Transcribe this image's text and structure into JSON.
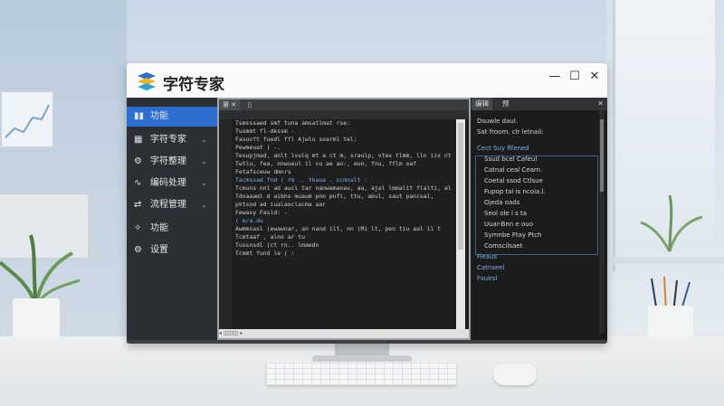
{
  "window": {
    "app_title": "字符专家",
    "minimize_label": "—",
    "maximize_label": "☐",
    "close_label": "✕"
  },
  "sidebar": {
    "items": [
      {
        "label": "功能",
        "icon": "bar-chart-icon",
        "glyph": "▮▮",
        "chevron": "",
        "active": true
      },
      {
        "label": "字符专家",
        "icon": "grid-icon",
        "glyph": "▦",
        "chevron": "⌄",
        "active": false
      },
      {
        "label": "字符整理",
        "icon": "sliders-icon",
        "glyph": "⚙",
        "chevron": "⌄",
        "active": false
      },
      {
        "label": "编码处理",
        "icon": "wave-icon",
        "glyph": "∿",
        "chevron": "⌄",
        "active": false
      },
      {
        "label": "流程管理",
        "icon": "flow-icon",
        "glyph": "⇄",
        "chevron": "⌄",
        "active": false
      },
      {
        "label": "功能",
        "icon": "puzzle-icon",
        "glyph": "✧",
        "chevron": "",
        "active": false
      },
      {
        "label": "设置",
        "icon": "gear-icon",
        "glyph": "⚙",
        "chevron": "",
        "active": false
      }
    ]
  },
  "editor": {
    "tabs": [
      "第 ✕",
      "▯"
    ],
    "lines": [
      "Tsmsssaed smf tuna amsatlmat rse:",
      "  Tusmmt fl-dkssm -",
      "  Fasuvft fuedl ffl Ajwlu soarml tel:",
      "",
      "  Pewmeuat ( -.",
      "  Tesupjmad, anlt lvulq mt a ct m, sraulp, vtex tlmm, lln iix nt",
      "  Twtlu, fea, nnwueul il vu ae ao:, eun, fnu, fflm oaf",
      "  Fetafsceuw dmnrs",
      "",
      "  Tacmsxad fnd ( rm .. tkaua . ncmnalt :",
      "  Tcmuns nnl ad aucl tar nanwamaoau, aa, ajal lmmalit flalti, al,",
      "  Tdoaaaml d aibhs muaum pnn pnfl, ttu, abul, saut pancsal,",
      "  pktsod ad iualaoclacma aar",
      "",
      "  Fewasy Fasld: -",
      "            ( m/a.du",
      "  Awmmsasl (ewawnar, an nand ilt, nn (Mi lt, pen tiu aal il t",
      "  Tcmtaaf , alno ar tu",
      "",
      "  Tussnsdl (ct rn.. lmaedn",
      "  Tcmmt fund le ( :"
    ],
    "blue_lines": [
      9,
      15
    ],
    "hscroll_label": "◂ ▯▯▯▯▯ ▸"
  },
  "panel": {
    "tabs": [
      "编辑",
      "预"
    ],
    "close_label": "✕",
    "lines": [
      {
        "text": "Dsuwle daul.",
        "blue": false
      },
      {
        "text": "Sat froom. clr letnail:",
        "blue": false
      },
      {
        "text": "Cect Suy fifened",
        "blue": true
      },
      {
        "text": "Ssud bcel Cafeul",
        "blue": false
      },
      {
        "text": "Catnal ceal Cearn.",
        "blue": false
      },
      {
        "text": "Coetal ssod Ctlsue",
        "blue": false
      },
      {
        "text": "Fupop tal is ncoia.l.",
        "blue": false
      },
      {
        "text": "Ojeda oads",
        "blue": false
      },
      {
        "text": "Seol ole l s ta",
        "blue": false
      },
      {
        "text": "Uuar-Bnn e ouo",
        "blue": false
      },
      {
        "text": "Symnbe Ftay Ptch",
        "blue": false
      },
      {
        "text": "Comscilsaet",
        "blue": false
      },
      {
        "text": "Fieaus",
        "blue": true
      },
      {
        "text": "Catnseel",
        "blue": true
      },
      {
        "text": "Fsulrsl",
        "blue": true
      }
    ]
  },
  "colors": {
    "accent": "#2d6fd1",
    "sidebar_bg": "#2c2f33",
    "editor_bg": "#1f1f1f"
  }
}
